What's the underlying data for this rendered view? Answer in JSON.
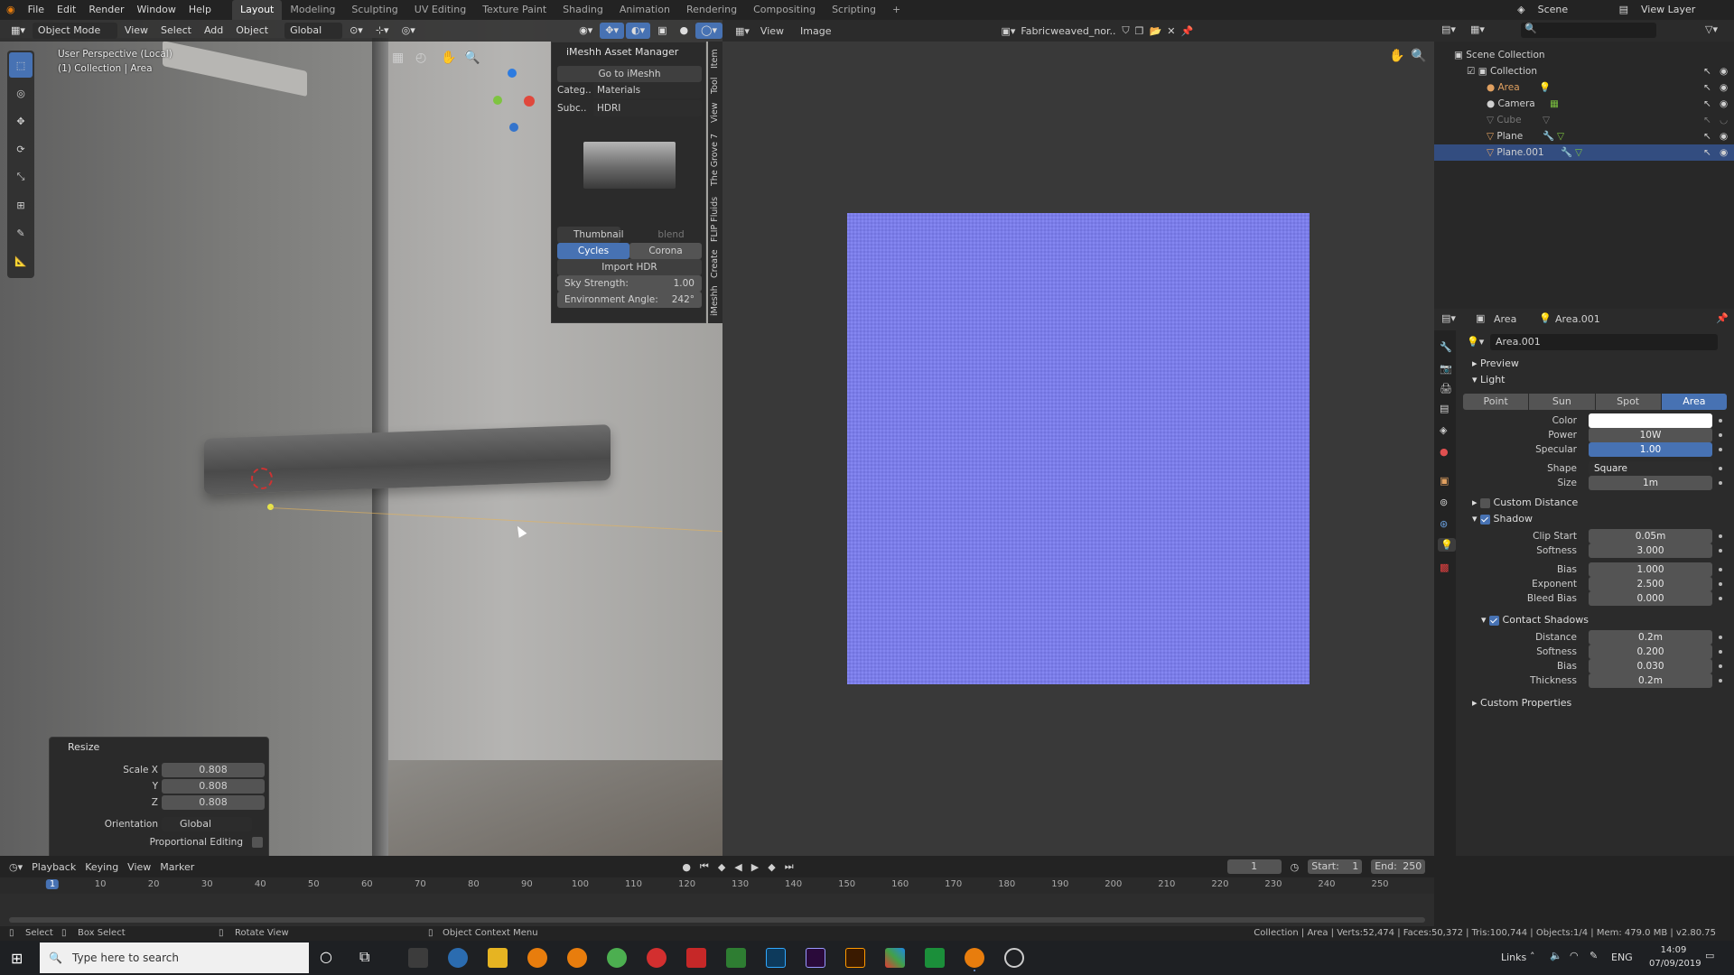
{
  "topbar": {
    "menu": [
      "File",
      "Edit",
      "Render",
      "Window",
      "Help"
    ],
    "workspaces": [
      "Layout",
      "Modeling",
      "Sculpting",
      "UV Editing",
      "Texture Paint",
      "Shading",
      "Animation",
      "Rendering",
      "Compositing",
      "Scripting"
    ],
    "active_workspace": "Layout",
    "scene": "Scene",
    "view_layer": "View Layer"
  },
  "viewport": {
    "mode": "Object Mode",
    "menus": [
      "View",
      "Select",
      "Add",
      "Object"
    ],
    "orientation": "Global",
    "overlay_line1": "User Perspective (Local)",
    "overlay_line2": "(1) Collection | Area"
  },
  "asset_manager": {
    "title": "iMeshh Asset Manager",
    "go_button": "Go to iMeshh",
    "category_label": "Categ..",
    "category_value": "Materials",
    "subcategory_label": "Subc..",
    "subcategory_value": "HDRI",
    "thumbnail_label": "Thumbnail",
    "blend_label": "blend",
    "engine_cycles": "Cycles",
    "engine_corona": "Corona",
    "import_button": "Import HDR",
    "sky_strength_label": "Sky Strength:",
    "sky_strength_value": "1.00",
    "env_angle_label": "Environment Angle:",
    "env_angle_value": "242°",
    "side_tabs": [
      "Item",
      "Tool",
      "View",
      "The Grove 7",
      "FLIP Fluids",
      "Create",
      "iMeshh"
    ]
  },
  "resize_panel": {
    "title": "Resize",
    "scale_x_label": "Scale X",
    "scale_x": "0.808",
    "y_label": "Y",
    "scale_y": "0.808",
    "z_label": "Z",
    "scale_z": "0.808",
    "orientation_label": "Orientation",
    "orientation_value": "Global",
    "prop_edit_label": "Proportional Editing"
  },
  "image_editor": {
    "menus": [
      "View",
      "Image"
    ],
    "image_name": "Fabricweaved_nor...",
    "image_color": "#7b7df0"
  },
  "outliner": {
    "root": "Scene Collection",
    "collection": "Collection",
    "items": [
      {
        "name": "Area",
        "color": "#e0a060"
      },
      {
        "name": "Camera",
        "color": "#d0d0d0"
      },
      {
        "name": "Cube",
        "color": "#777777"
      },
      {
        "name": "Plane",
        "color": "#d0d0d0"
      },
      {
        "name": "Plane.001",
        "color": "#d0d0d0"
      }
    ]
  },
  "properties": {
    "breadcrumb_obj": "Area",
    "breadcrumb_data": "Area.001",
    "datablock": "Area.001",
    "preview": "Preview",
    "light_section": "Light",
    "light_types": [
      "Point",
      "Sun",
      "Spot",
      "Area"
    ],
    "active_light_type": "Area",
    "color_label": "Color",
    "power_label": "Power",
    "power": "10W",
    "specular_label": "Specular",
    "specular": "1.00",
    "shape_label": "Shape",
    "shape": "Square",
    "size_label": "Size",
    "size": "1m",
    "custom_distance": "Custom Distance",
    "shadow": "Shadow",
    "clip_start_label": "Clip Start",
    "clip_start": "0.05m",
    "softness_label": "Softness",
    "softness": "3.000",
    "bias_label": "Bias",
    "bias": "1.000",
    "exponent_label": "Exponent",
    "exponent": "2.500",
    "bleed_bias_label": "Bleed Bias",
    "bleed_bias": "0.000",
    "contact_shadows": "Contact Shadows",
    "distance_label": "Distance",
    "distance": "0.2m",
    "cs_softness_label": "Softness",
    "cs_softness": "0.200",
    "cs_bias_label": "Bias",
    "cs_bias": "0.030",
    "thickness_label": "Thickness",
    "thickness": "0.2m",
    "custom_properties": "Custom Properties"
  },
  "timeline": {
    "menus": [
      "Playback",
      "Keying",
      "View",
      "Marker"
    ],
    "current_frame": "1",
    "start_label": "Start:",
    "start": "1",
    "end_label": "End:",
    "end": "250",
    "ticks": [
      "1",
      "10",
      "20",
      "30",
      "40",
      "50",
      "60",
      "70",
      "80",
      "90",
      "100",
      "110",
      "120",
      "130",
      "140",
      "150",
      "160",
      "170",
      "180",
      "190",
      "200",
      "210",
      "220",
      "230",
      "240",
      "250"
    ]
  },
  "statusbar": {
    "select": "Select",
    "box_select": "Box Select",
    "rotate_view": "Rotate View",
    "context_menu": "Object Context Menu",
    "stats": "Collection | Area | Verts:52,474 | Faces:50,372 | Tris:100,744 | Objects:1/4 | Mem: 479.0 MB | v2.80.75"
  },
  "taskbar": {
    "search_placeholder": "Type here to search",
    "links": "Links",
    "lang": "ENG",
    "time": "14:09",
    "date": "07/09/2019"
  }
}
